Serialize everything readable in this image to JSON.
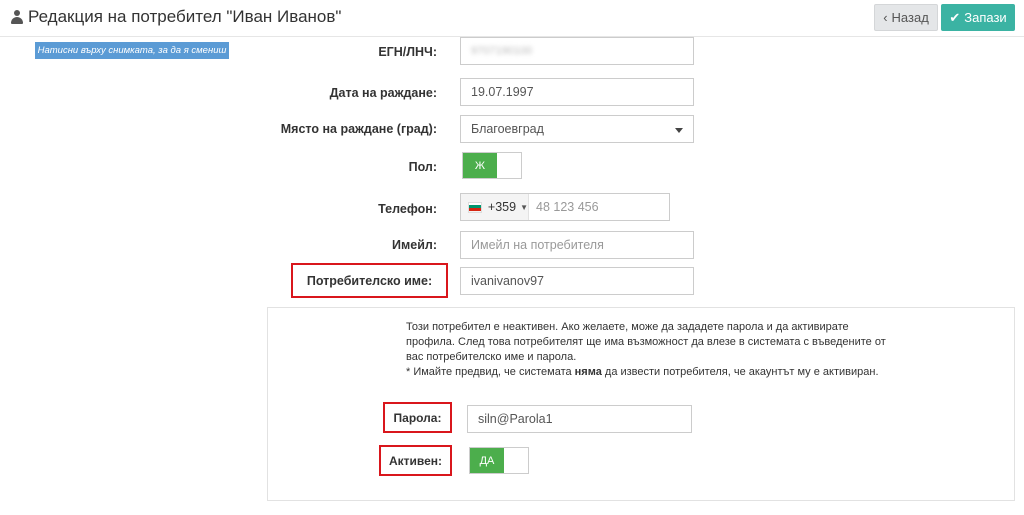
{
  "header": {
    "title": "Редакция на потребител \"Иван Иванов\"",
    "back_label": "Назад",
    "save_label": "Запази"
  },
  "photo_hint": "Натисни върху снимката, за да я смениш",
  "form": {
    "egn": {
      "label": "ЕГН/ЛНЧ:",
      "value": "9707190100"
    },
    "birth_date": {
      "label": "Дата на раждане:",
      "value": "19.07.1997"
    },
    "birth_place": {
      "label": "Място на раждане (град):",
      "value": "Благоевград"
    },
    "gender": {
      "label": "Пол:",
      "value": "Ж"
    },
    "phone": {
      "label": "Телефон:",
      "country_code": "+359",
      "placeholder": "48 123 456"
    },
    "email": {
      "label": "Имейл:",
      "placeholder": "Имейл на потребителя"
    },
    "username": {
      "label": "Потребителско име:",
      "value": "ivanivanov97"
    }
  },
  "activation": {
    "notice_line1": "Този потребител е неактивен. Ако желаете, може да зададете парола и да активирате",
    "notice_line2": "профила. След това потребителят ще има възможност да влезе в системата с въведените от",
    "notice_line3": "вас потребителско име и парола.",
    "notice_line4_pre": "* Имайте предвид, че системата ",
    "notice_line4_bold": "няма",
    "notice_line4_post": " да извести потребителя, че акаунтът му е активиран.",
    "password": {
      "label": "Парола:",
      "value": "siln@Parola1"
    },
    "active": {
      "label": "Активен:",
      "value": "ДА"
    }
  },
  "colors": {
    "save_button": "#3bb3a3",
    "toggle_on": "#4cae4c",
    "highlight_box": "#d9161c",
    "photo_hint_bg": "#5b9bd5"
  },
  "icons": {
    "title_icon": "user-icon",
    "back_icon": "chevron-left-icon",
    "save_icon": "check-icon",
    "flag": "bulgaria-flag-icon",
    "dropdown": "caret-down-icon"
  }
}
